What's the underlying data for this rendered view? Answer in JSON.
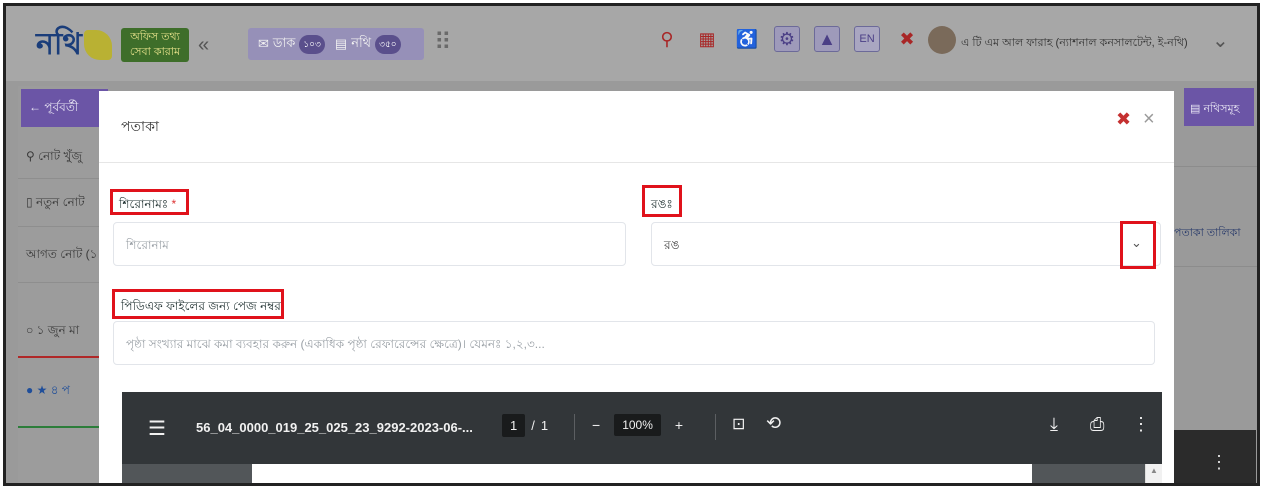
{
  "header": {
    "logo_text": "নথি",
    "office_info_label": "অফিস তথ্য সেবা কারাম",
    "collapse_symbol": "«",
    "dak": {
      "label": "ডাক",
      "count": "১০৩"
    },
    "nothi": {
      "label": "নথি",
      "count": "৩৫০"
    },
    "language_label": "EN",
    "user_name": "এ টি এম আল ফারাহ (ন্যাশনাল কনসালটেন্ট, ই-নথি)"
  },
  "sidebar": {
    "back_label": "পূর্ববর্তী",
    "search_note_label": "নোট খুঁজু",
    "new_note_label": "নতুন নোট",
    "incoming_note_label": "আগত নোট (১",
    "item1_label": "১ জুন মা",
    "item2_label": "৪ প"
  },
  "right": {
    "nothi_list_label": "নথিসমূহ",
    "flag_list_label": "পতাকা তালিকা"
  },
  "modal": {
    "title": "পতাকা",
    "form": {
      "title_label": "শিরোনামঃ",
      "required_mark": "*",
      "title_placeholder": "শিরোনাম",
      "color_label": "রঙঃ",
      "color_value": "রঙ",
      "page_number_label": "পিডিএফ ফাইলের জন্য পেজ নম্বর",
      "page_number_placeholder": "পৃষ্ঠা সংখ্যার মাঝে কমা ব্যবহার করুন (একাধিক পৃষ্ঠা রেফারেন্সের ক্ষেত্রে)। যেমনঃ ১,২,৩..."
    },
    "pdf": {
      "file_name": "56_04_0000_019_25_025_23_9292-2023-06-...",
      "current_page": "1",
      "page_separator": "/",
      "total_pages": "1",
      "zoom": "100%"
    }
  },
  "colors": {
    "accent_purple": "#6b55a6",
    "highlight_red": "#e0121b",
    "pdf_toolbar": "#323639"
  }
}
